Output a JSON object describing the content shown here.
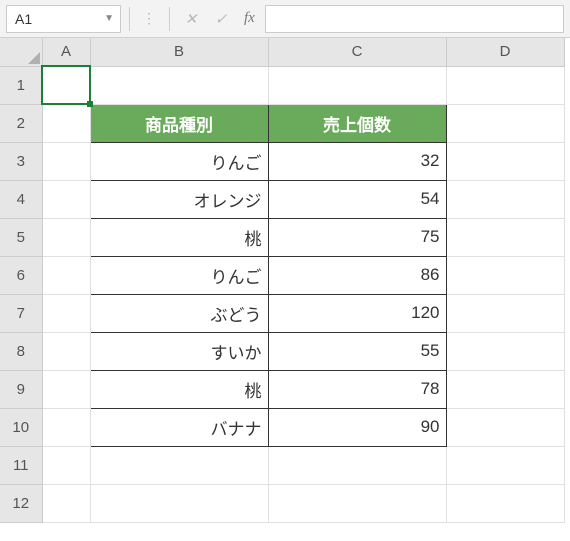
{
  "nameBox": "A1",
  "formulaValue": "",
  "columns": [
    "A",
    "B",
    "C",
    "D"
  ],
  "rowCount": 12,
  "tableHeader": {
    "b": "商品種別",
    "c": "売上個数"
  },
  "rows": [
    {
      "b": "りんご",
      "c": "32"
    },
    {
      "b": "オレンジ",
      "c": "54"
    },
    {
      "b": "桃",
      "c": "75"
    },
    {
      "b": "りんご",
      "c": "86"
    },
    {
      "b": "ぶどう",
      "c": "120"
    },
    {
      "b": "すいか",
      "c": "55"
    },
    {
      "b": "桃",
      "c": "78"
    },
    {
      "b": "バナナ",
      "c": "90"
    }
  ],
  "icons": {
    "cancel": "✕",
    "confirm": "✓",
    "fx": "fx"
  }
}
